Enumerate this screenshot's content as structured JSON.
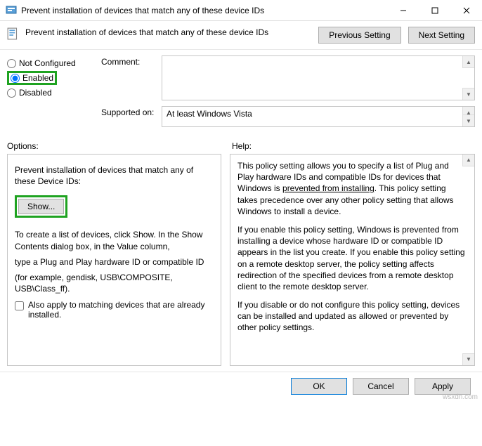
{
  "window": {
    "title": "Prevent installation of devices that match any of these device IDs"
  },
  "header": {
    "title": "Prevent installation of devices that match any of these device IDs",
    "prev": "Previous Setting",
    "next": "Next Setting"
  },
  "radios": {
    "not_configured": "Not Configured",
    "enabled": "Enabled",
    "disabled": "Disabled"
  },
  "labels": {
    "comment": "Comment:",
    "supported_on": "Supported on:",
    "options": "Options:",
    "help": "Help:"
  },
  "supported_value": "At least Windows Vista",
  "options_pane": {
    "heading": "Prevent installation of devices that match any of these Device IDs:",
    "show_button": "Show...",
    "line1": "To create a list of devices, click Show. In the Show Contents dialog box, in the Value column,",
    "line2": "type a Plug and Play hardware ID or compatible ID",
    "line3": "(for example, gendisk, USB\\COMPOSITE, USB\\Class_ff).",
    "checkbox": "Also apply to matching devices that are already installed."
  },
  "help_pane": {
    "p1a": "This policy setting allows you to specify a list of Plug and Play hardware IDs and compatible IDs for devices that Windows is ",
    "p1b": "prevented from installing",
    "p1c": ". This policy setting takes precedence over any other policy setting that allows Windows to install a device.",
    "p2": "If you enable this policy setting, Windows is prevented from installing a device whose hardware ID or compatible ID appears in the list you create. If you enable this policy setting on a remote desktop server, the policy setting affects redirection of the specified devices from a remote desktop client to the remote desktop server.",
    "p3": "If you disable or do not configure this policy setting, devices can be installed and updated as allowed or prevented by other policy settings."
  },
  "footer": {
    "ok": "OK",
    "cancel": "Cancel",
    "apply": "Apply"
  },
  "watermark": "wsxdn.com"
}
